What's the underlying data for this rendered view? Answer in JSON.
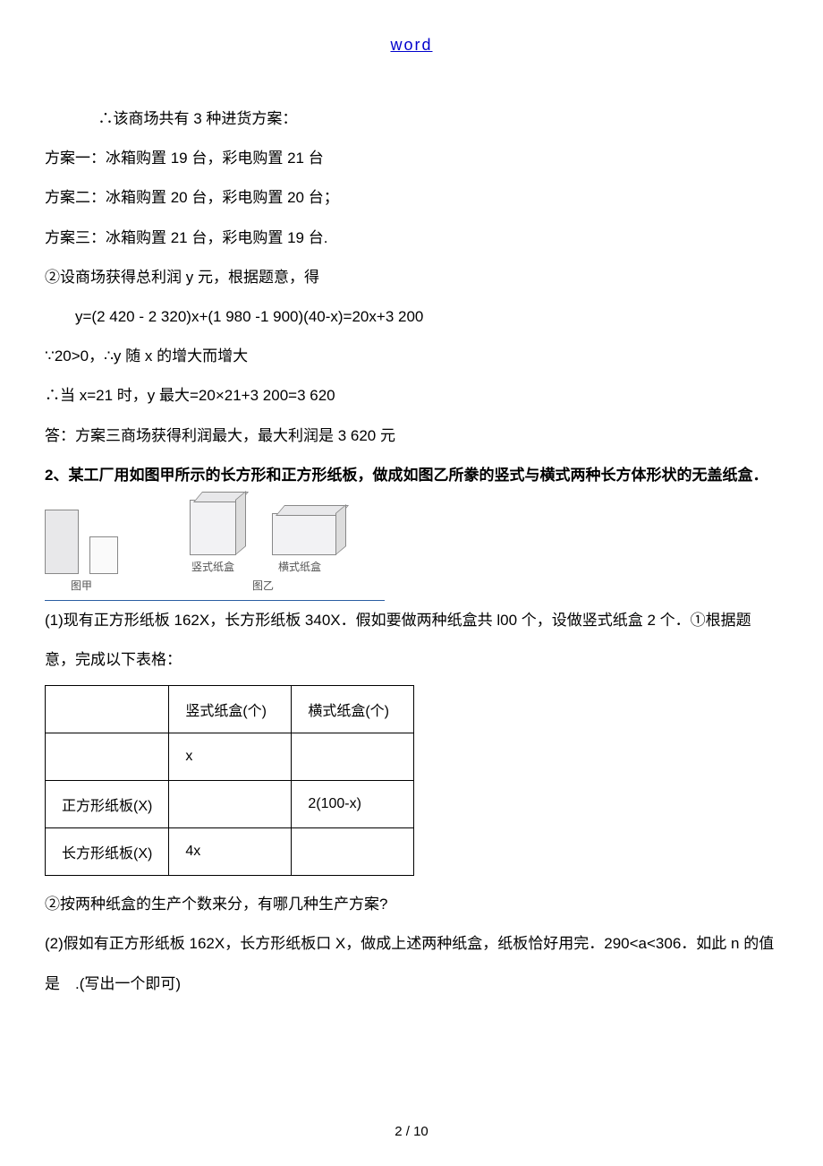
{
  "header": {
    "title": "word"
  },
  "body": {
    "l1": "∴该商场共有 3 种进货方案：",
    "l2": "方案一：冰箱购置 19 台，彩电购置 21 台",
    "l3": "方案二：冰箱购置 20 台，彩电购置 20 台；",
    "l4": "方案三：冰箱购置 21 台，彩电购置 19 台.",
    "l5": "②设商场获得总利润 y 元，根据题意，得",
    "l6": "y=(2 420 - 2 320)x+(1 980 -1 900)(40-x)=20x+3 200",
    "l7": "∵20>0，∴y 随 x 的增大而增大",
    "l8": "∴当 x=21 时，y 最大=20×21+3 200=3 620",
    "l9": "答：方案三商场获得利润最大，最大利润是 3 620 元",
    "q2": "2、某工厂用如图甲所示的长方形和正方形纸板，做成如图乙所豢的竖式与横式两种长方体形状的无盖纸盒．",
    "fig": {
      "cap_jia": "图甲",
      "cap_v": "竖式纸盒",
      "cap_h": "横式纸盒",
      "cap_yi": "图乙"
    },
    "q2_1": "(1)现有正方形纸板 162X，长方形纸板 340X．假如要做两种纸盒共 l00 个，设做竖式纸盒 2 个．①根据题意，完成以下表格：",
    "table": {
      "h1": "",
      "h2": "竖式纸盒(个)",
      "h3": "横式纸盒(个)",
      "r1c1": "",
      "r1c2": "x",
      "r1c3": "",
      "r2c1": "正方形纸板(X)",
      "r2c2": "",
      "r2c3": "2(100-x)",
      "r3c1": "长方形纸板(X)",
      "r3c2": "4x",
      "r3c3": ""
    },
    "q2_2": "②按两种纸盒的生产个数来分，有哪几种生产方案?",
    "q2_3": "(2)假如有正方形纸板 162X，长方形纸板口 X，做成上述两种纸盒，纸板恰好用完．290<a<306．如此 n 的值是 .(写出一个即可)"
  },
  "footer": {
    "page": "2 / 10"
  }
}
